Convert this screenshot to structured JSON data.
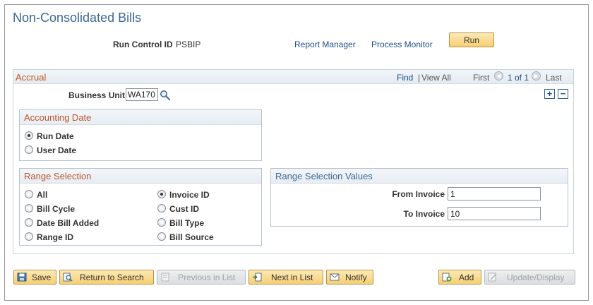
{
  "page": {
    "title": "Non-Consolidated Bills"
  },
  "run_control": {
    "label": "Run Control ID",
    "value": "PSBIP",
    "report_manager": "Report Manager",
    "process_monitor": "Process Monitor",
    "run_label": "Run"
  },
  "accrual": {
    "title": "Accrual",
    "nav": {
      "find": "Find",
      "sep": "|",
      "view_all": "View All",
      "first": "First",
      "count": "1 of 1",
      "last": "Last"
    },
    "business_unit": {
      "label": "Business Unit",
      "value": "WA170"
    },
    "plus": "+",
    "minus": "−"
  },
  "accounting_date": {
    "title": "Accounting Date",
    "options": [
      {
        "label": "Run Date",
        "selected": true
      },
      {
        "label": "User Date",
        "selected": false
      }
    ]
  },
  "range_selection": {
    "title": "Range Selection",
    "options": [
      {
        "label": "All",
        "selected": false
      },
      {
        "label": "Bill Cycle",
        "selected": false
      },
      {
        "label": "Date Bill Added",
        "selected": false
      },
      {
        "label": "Range ID",
        "selected": false
      },
      {
        "label": "Invoice ID",
        "selected": true
      },
      {
        "label": "Cust ID",
        "selected": false
      },
      {
        "label": "Bill Type",
        "selected": false
      },
      {
        "label": "Bill Source",
        "selected": false
      }
    ]
  },
  "range_values": {
    "title": "Range Selection Values",
    "from_label": "From Invoice",
    "from_value": "1",
    "to_label": "To Invoice",
    "to_value": "10"
  },
  "toolbar": {
    "save": "Save",
    "return_to_search": "Return to Search",
    "previous_in_list": "Previous in List",
    "next_in_list": "Next in List",
    "notify": "Notify",
    "add": "Add",
    "update_display": "Update/Display"
  },
  "colors": {
    "link": "#1f4e85",
    "section_title": "#c0571f",
    "button_fill": "#f6cf74"
  }
}
